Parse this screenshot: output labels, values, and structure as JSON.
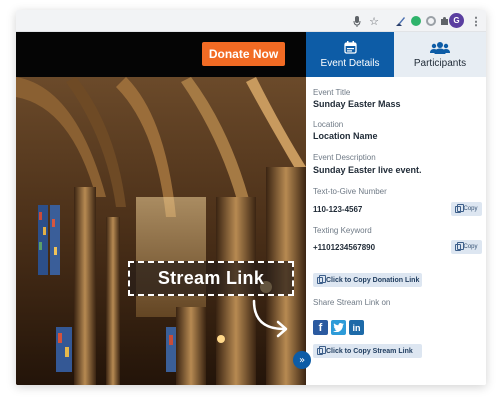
{
  "video": {
    "donate_label": "Donate Now",
    "overlay_label": "Stream Link"
  },
  "tabs": [
    {
      "label": "Event Details",
      "icon": "calendar-icon",
      "active": true
    },
    {
      "label": "Participants",
      "icon": "users-icon",
      "active": false
    }
  ],
  "details": {
    "event_title_label": "Event Title",
    "event_title": "Sunday Easter Mass",
    "location_label": "Location",
    "location": "Location Name",
    "description_label": "Event Description",
    "description": "Sunday Easter live event.",
    "text_to_give_label": "Text-to-Give Number",
    "text_to_give": "110-123-4567",
    "keyword_label": "Texting Keyword",
    "keyword": "+1101234567890",
    "copy_label": "Copy",
    "copy_donation_label": "Click to Copy Donation Link",
    "share_label": "Share Stream Link on",
    "copy_stream_label": "Click to Copy Stream Link"
  },
  "browser": {
    "avatar_letter": "G"
  },
  "colors": {
    "primary": "#0d5ca6",
    "donate": "#f26b24",
    "tab_inactive": "#e7edf3"
  }
}
